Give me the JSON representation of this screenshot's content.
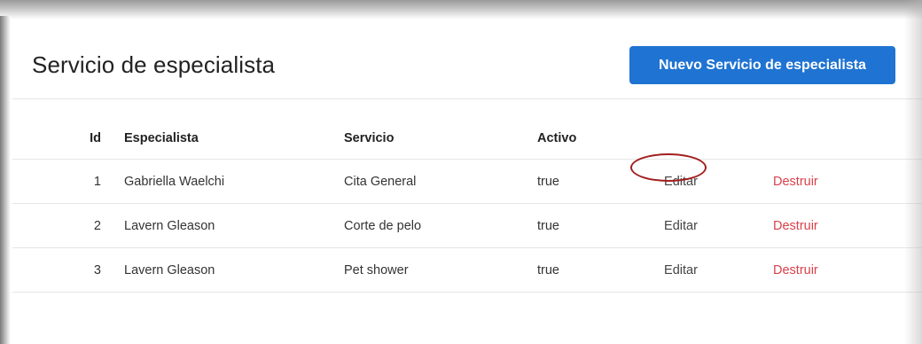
{
  "page": {
    "title": "Servicio de especialista",
    "new_button_label": "Nuevo Servicio de especialista"
  },
  "table": {
    "headers": {
      "id": "Id",
      "especialista": "Especialista",
      "servicio": "Servicio",
      "activo": "Activo"
    },
    "rows": [
      {
        "id": "1",
        "especialista": "Gabriella Waelchi",
        "servicio": "Cita General",
        "activo": "true",
        "edit": "Editar",
        "destroy": "Destruir"
      },
      {
        "id": "2",
        "especialista": "Lavern Gleason",
        "servicio": "Corte de pelo",
        "activo": "true",
        "edit": "Editar",
        "destroy": "Destruir"
      },
      {
        "id": "3",
        "especialista": "Lavern Gleason",
        "servicio": "Pet shower",
        "activo": "true",
        "edit": "Editar",
        "destroy": "Destruir"
      }
    ]
  },
  "colors": {
    "primary_button": "#1f73d2",
    "destroy_link": "#d9414b",
    "highlight": "#a11e1e"
  }
}
